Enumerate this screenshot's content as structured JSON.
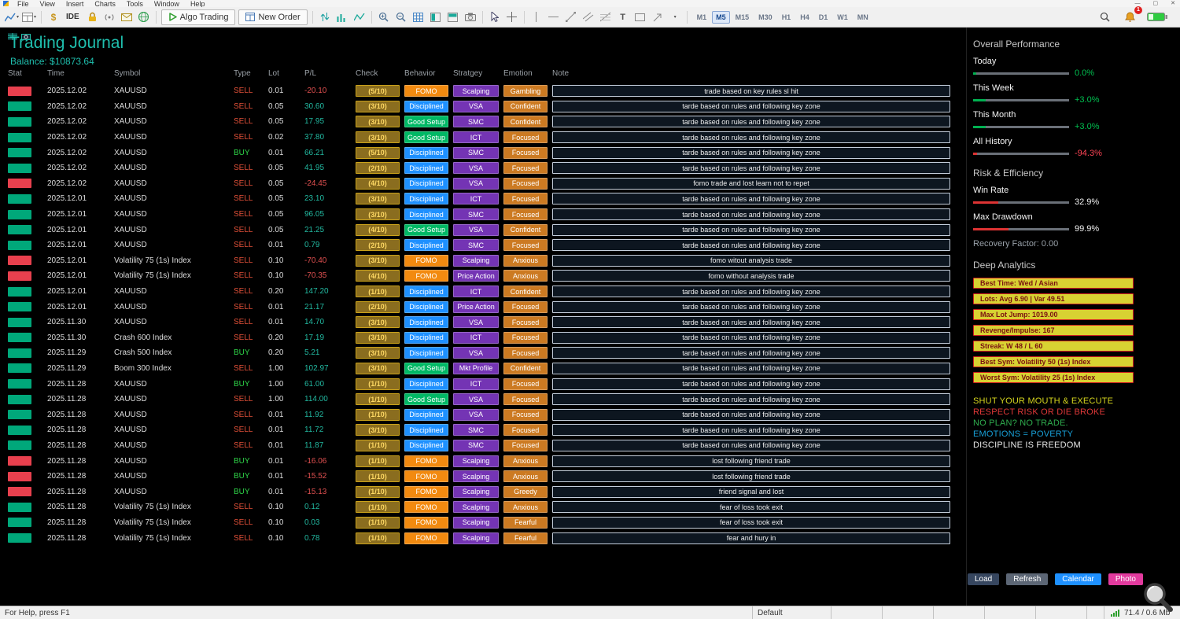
{
  "window": {
    "menus": [
      "File",
      "View",
      "Insert",
      "Charts",
      "Tools",
      "Window",
      "Help"
    ],
    "controls": [
      "—",
      "▢",
      "✕"
    ]
  },
  "toolbar": {
    "ide_label": "IDE",
    "algo_trading_label": "Algo Trading",
    "new_order_label": "New Order",
    "timeframes": [
      "M1",
      "M5",
      "M15",
      "M30",
      "H1",
      "H4",
      "D1",
      "W1",
      "MN"
    ],
    "active_timeframe": "M5",
    "notification_badge": "1"
  },
  "journal": {
    "title": "Trading Journal",
    "balance": "Balance: $10873.64",
    "columns": [
      "Stat",
      "Time",
      "Symbol",
      "Type",
      "Lot",
      "P/L",
      "Check",
      "Behavior",
      "Stratgey",
      "Emotion",
      "Note"
    ],
    "rows": [
      [
        "L",
        "2025.12.02",
        "XAUUSD",
        "SELL",
        "0.01",
        "-20.10",
        "(5/10)",
        "FOMO",
        "Scalping",
        "Gambling",
        "trade based on key rules sl hit"
      ],
      [
        "W",
        "2025.12.02",
        "XAUUSD",
        "SELL",
        "0.05",
        "30.60",
        "(3/10)",
        "Disciplined",
        "VSA",
        "Confident",
        "tarde based on rules and following key zone"
      ],
      [
        "W",
        "2025.12.02",
        "XAUUSD",
        "SELL",
        "0.05",
        "17.95",
        "(3/10)",
        "Good Setup",
        "SMC",
        "Confident",
        "tarde based on rules and following key zone"
      ],
      [
        "W",
        "2025.12.02",
        "XAUUSD",
        "SELL",
        "0.02",
        "37.80",
        "(3/10)",
        "Good Setup",
        "ICT",
        "Focused",
        "tarde based on rules and following key zone"
      ],
      [
        "W",
        "2025.12.02",
        "XAUUSD",
        "BUY",
        "0.01",
        "66.21",
        "(5/10)",
        "Disciplined",
        "SMC",
        "Focused",
        "tarde based on rules and following key zone"
      ],
      [
        "W",
        "2025.12.02",
        "XAUUSD",
        "SELL",
        "0.05",
        "41.95",
        "(2/10)",
        "Disciplined",
        "VSA",
        "Focused",
        "tarde based on rules and following key zone"
      ],
      [
        "L",
        "2025.12.02",
        "XAUUSD",
        "SELL",
        "0.05",
        "-24.45",
        "(4/10)",
        "Disciplined",
        "VSA",
        "Focused",
        "fomo trade and lost learn not to repet"
      ],
      [
        "W",
        "2025.12.01",
        "XAUUSD",
        "SELL",
        "0.05",
        "23.10",
        "(3/10)",
        "Disciplined",
        "ICT",
        "Focused",
        "tarde based on rules and following key zone"
      ],
      [
        "W",
        "2025.12.01",
        "XAUUSD",
        "SELL",
        "0.05",
        "96.05",
        "(3/10)",
        "Disciplined",
        "SMC",
        "Focused",
        "tarde based on rules and following key zone"
      ],
      [
        "W",
        "2025.12.01",
        "XAUUSD",
        "SELL",
        "0.05",
        "21.25",
        "(4/10)",
        "Good Setup",
        "VSA",
        "Confident",
        "tarde based on rules and following key zone"
      ],
      [
        "W",
        "2025.12.01",
        "XAUUSD",
        "SELL",
        "0.01",
        "0.79",
        "(2/10)",
        "Disciplined",
        "SMC",
        "Focused",
        "tarde based on rules and following key zone"
      ],
      [
        "L",
        "2025.12.01",
        "Volatility 75 (1s) Index",
        "SELL",
        "0.10",
        "-70.40",
        "(3/10)",
        "FOMO",
        "Scalping",
        "Anxious",
        "fomo witout analysis trade"
      ],
      [
        "L",
        "2025.12.01",
        "Volatility 75 (1s) Index",
        "SELL",
        "0.10",
        "-70.35",
        "(4/10)",
        "FOMO",
        "Price Action",
        "Anxious",
        "fomo without analysis trade"
      ],
      [
        "W",
        "2025.12.01",
        "XAUUSD",
        "SELL",
        "0.20",
        "147.20",
        "(1/10)",
        "Disciplined",
        "ICT",
        "Confident",
        "tarde based on rules and following key zone"
      ],
      [
        "W",
        "2025.12.01",
        "XAUUSD",
        "SELL",
        "0.01",
        "21.17",
        "(2/10)",
        "Disciplined",
        "Price Action",
        "Focused",
        "tarde based on rules and following key zone"
      ],
      [
        "W",
        "2025.11.30",
        "XAUUSD",
        "SELL",
        "0.01",
        "14.70",
        "(3/10)",
        "Disciplined",
        "VSA",
        "Focused",
        "tarde based on rules and following key zone"
      ],
      [
        "W",
        "2025.11.30",
        "Crash 600 Index",
        "SELL",
        "0.20",
        "17.19",
        "(3/10)",
        "Disciplined",
        "ICT",
        "Focused",
        "tarde based on rules and following key zone"
      ],
      [
        "W",
        "2025.11.29",
        "Crash 500 Index",
        "BUY",
        "0.20",
        "5.21",
        "(3/10)",
        "Disciplined",
        "VSA",
        "Focused",
        "tarde based on rules and following key zone"
      ],
      [
        "W",
        "2025.11.29",
        "Boom 300 Index",
        "SELL",
        "1.00",
        "102.97",
        "(3/10)",
        "Good Setup",
        "Mkt Profile",
        "Confident",
        "tarde based on rules and following key zone"
      ],
      [
        "W",
        "2025.11.28",
        "XAUUSD",
        "BUY",
        "1.00",
        "61.00",
        "(1/10)",
        "Disciplined",
        "ICT",
        "Focused",
        "tarde based on rules and following key zone"
      ],
      [
        "W",
        "2025.11.28",
        "XAUUSD",
        "SELL",
        "1.00",
        "114.00",
        "(1/10)",
        "Good Setup",
        "VSA",
        "Focused",
        "tarde based on rules and following key zone"
      ],
      [
        "W",
        "2025.11.28",
        "XAUUSD",
        "SELL",
        "0.01",
        "11.92",
        "(1/10)",
        "Disciplined",
        "VSA",
        "Focused",
        "tarde based on rules and following key zone"
      ],
      [
        "W",
        "2025.11.28",
        "XAUUSD",
        "SELL",
        "0.01",
        "11.72",
        "(3/10)",
        "Disciplined",
        "SMC",
        "Focused",
        "tarde based on rules and following key zone"
      ],
      [
        "W",
        "2025.11.28",
        "XAUUSD",
        "SELL",
        "0.01",
        "11.87",
        "(1/10)",
        "Disciplined",
        "SMC",
        "Focused",
        "tarde based on rules and following key zone"
      ],
      [
        "L",
        "2025.11.28",
        "XAUUSD",
        "BUY",
        "0.01",
        "-16.06",
        "(1/10)",
        "FOMO",
        "Scalping",
        "Anxious",
        "lost following friend trade"
      ],
      [
        "L",
        "2025.11.28",
        "XAUUSD",
        "BUY",
        "0.01",
        "-15.52",
        "(1/10)",
        "FOMO",
        "Scalping",
        "Anxious",
        "lost following friend trade"
      ],
      [
        "L",
        "2025.11.28",
        "XAUUSD",
        "BUY",
        "0.01",
        "-15.13",
        "(1/10)",
        "FOMO",
        "Scalping",
        "Greedy",
        "friend signal and lost"
      ],
      [
        "W",
        "2025.11.28",
        "Volatility 75 (1s) Index",
        "SELL",
        "0.10",
        "0.12",
        "(1/10)",
        "FOMO",
        "Scalping",
        "Anxious",
        "fear of loss took exit"
      ],
      [
        "W",
        "2025.11.28",
        "Volatility 75 (1s) Index",
        "SELL",
        "0.10",
        "0.03",
        "(1/10)",
        "FOMO",
        "Scalping",
        "Fearful",
        "fear of loss took exit"
      ],
      [
        "W",
        "2025.11.28",
        "Volatility 75 (1s) Index",
        "SELL",
        "0.10",
        "0.78",
        "(1/10)",
        "FOMO",
        "Scalping",
        "Fearful",
        "fear and hury in"
      ]
    ]
  },
  "panel": {
    "performance": {
      "title": "Overall Performance",
      "items": [
        {
          "label": "Today",
          "value": "0.0%",
          "value_color": "#00c050",
          "fill": 3,
          "bar": "#00b050"
        },
        {
          "label": "This Week",
          "value": "+3.0%",
          "value_color": "#00c050",
          "fill": 13,
          "bar": "#00b050"
        },
        {
          "label": "This Month",
          "value": "+3.0%",
          "value_color": "#00c050",
          "fill": 13,
          "bar": "#00b050"
        },
        {
          "label": "All History",
          "value": "-94.3%",
          "value_color": "#ff4455",
          "fill": 4,
          "bar": "#dd3333"
        }
      ]
    },
    "risk": {
      "title": "Risk & Efficiency",
      "items": [
        {
          "label": "Win Rate",
          "value": "32.9%",
          "value_color": "#f0f0f0",
          "fill": 26,
          "bar": "#dd3333"
        },
        {
          "label": "Max Drawdown",
          "value": "99.9%",
          "value_color": "#f0f0f0",
          "fill": 37,
          "bar": "#dd3333"
        }
      ],
      "recovery_label": "Recovery Factor: 0.00"
    },
    "analytics": {
      "title": "Deep Analytics",
      "badges": [
        "Best Time: Wed / Asian",
        "Lots: Avg 6.90 | Var 49.51",
        "Max Lot Jump: 1019.00",
        "Revenge/Impulse: 167",
        "Streak: W 48 / L 60",
        "Best Sym: Volatility 50 (1s) Index",
        "Worst Sym: Volatility 25 (1s) Index"
      ]
    },
    "quotes": [
      {
        "text": "SHUT YOUR MOUTH & EXECUTE",
        "color": "#d6d61e"
      },
      {
        "text": "RESPECT RISK OR DIE BROKE",
        "color": "#e03838"
      },
      {
        "text": "NO PLAN? NO TRADE.",
        "color": "#2fae4e"
      },
      {
        "text": "EMOTIONS = POVERTY",
        "color": "#18a0d8"
      },
      {
        "text": "DISCIPLINE IS FREEDOM",
        "color": "#e8e8e8"
      }
    ],
    "buttons": [
      {
        "label": "Load",
        "bg": "#36465f"
      },
      {
        "label": "Refresh",
        "bg": "#5c6675"
      },
      {
        "label": "Calendar",
        "bg": "#1e90ff"
      },
      {
        "label": "Photo",
        "bg": "#e23a9e"
      }
    ]
  },
  "statusbar": {
    "help": "For Help, press F1",
    "profile": "Default",
    "traffic": "71.4 / 0.6 Mb"
  },
  "colors": {
    "accent_teal": "#1fbfae",
    "win": "#00a87a",
    "loss": "#e8404e",
    "sell": "#e05038",
    "buy": "#2fd348",
    "pl_pos": "#22b8a0",
    "pl_neg": "#e05050",
    "behavior": {
      "FOMO": "#f28a10",
      "Disciplined": "#1e90ff",
      "Good Setup": "#00b865"
    },
    "strategy_bg": "#7434b4",
    "emotion_bg": "#cc7a22",
    "check_bg": "#8a6d1f",
    "check_border": "#caa21a",
    "check_text": "#ffd964",
    "badge_bg": "#d8d232",
    "badge_border": "#cc2020",
    "badge_text": "#7a1010"
  }
}
